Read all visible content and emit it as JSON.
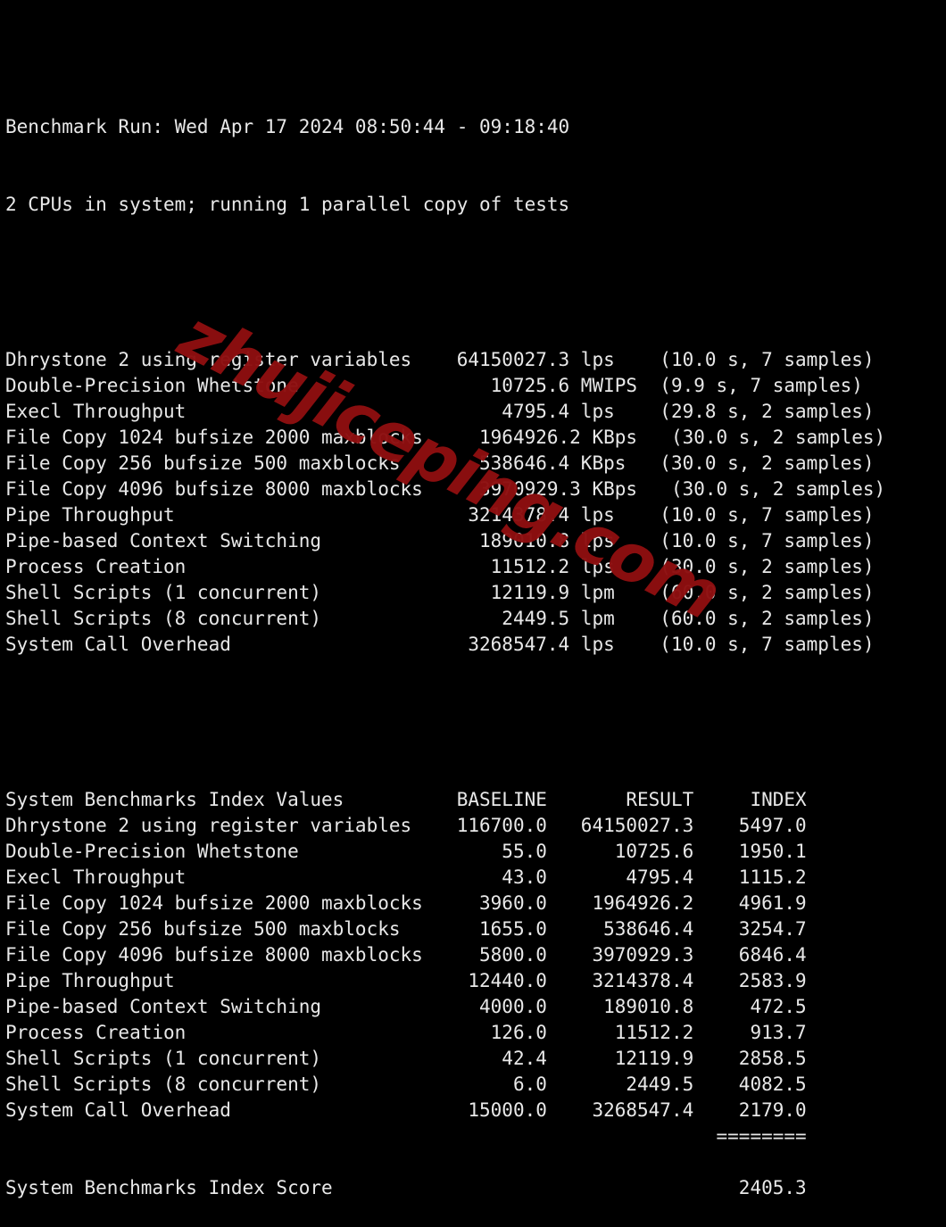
{
  "terminal": {
    "background_color": "#000000",
    "text_color": "#e8e8e8",
    "separator_top": "------------------------------------------------------------------------",
    "header": {
      "run_line": "Benchmark Run: Wed Apr 17 2024 08:50:44 - 09:18:40",
      "cpu_line": "2 CPUs in system; running 1 parallel copy of tests"
    },
    "results": {
      "rows": [
        {
          "name": "Dhrystone 2 using register variables",
          "value": "64150027.3",
          "unit": "lps",
          "detail": "(10.0 s, 7 samples)"
        },
        {
          "name": "Double-Precision Whetstone",
          "value": "10725.6",
          "unit": "MWIPS",
          "detail": "(9.9 s, 7 samples)"
        },
        {
          "name": "Execl Throughput",
          "value": "4795.4",
          "unit": "lps",
          "detail": "(29.8 s, 2 samples)"
        },
        {
          "name": "File Copy 1024 bufsize 2000 maxblocks",
          "value": "1964926.2",
          "unit": "KBps",
          "detail": "(30.0 s, 2 samples)"
        },
        {
          "name": "File Copy 256 bufsize 500 maxblocks",
          "value": "538646.4",
          "unit": "KBps",
          "detail": "(30.0 s, 2 samples)"
        },
        {
          "name": "File Copy 4096 bufsize 8000 maxblocks",
          "value": "3970929.3",
          "unit": "KBps",
          "detail": "(30.0 s, 2 samples)"
        },
        {
          "name": "Pipe Throughput",
          "value": "3214378.4",
          "unit": "lps",
          "detail": "(10.0 s, 7 samples)"
        },
        {
          "name": "Pipe-based Context Switching",
          "value": "189010.8",
          "unit": "lps",
          "detail": "(10.0 s, 7 samples)"
        },
        {
          "name": "Process Creation",
          "value": "11512.2",
          "unit": "lps",
          "detail": "(30.0 s, 2 samples)"
        },
        {
          "name": "Shell Scripts (1 concurrent)",
          "value": "12119.9",
          "unit": "lpm",
          "detail": "(60.0 s, 2 samples)"
        },
        {
          "name": "Shell Scripts (8 concurrent)",
          "value": "2449.5",
          "unit": "lpm",
          "detail": "(60.0 s, 2 samples)"
        },
        {
          "name": "System Call Overhead",
          "value": "3268547.4",
          "unit": "lps",
          "detail": "(10.0 s, 7 samples)"
        }
      ]
    },
    "index_table": {
      "title": "System Benchmarks Index Values",
      "columns": [
        "BASELINE",
        "RESULT",
        "INDEX"
      ],
      "rows": [
        {
          "name": "Dhrystone 2 using register variables",
          "baseline": "116700.0",
          "result": "64150027.3",
          "index": "5497.0"
        },
        {
          "name": "Double-Precision Whetstone",
          "baseline": "55.0",
          "result": "10725.6",
          "index": "1950.1"
        },
        {
          "name": "Execl Throughput",
          "baseline": "43.0",
          "result": "4795.4",
          "index": "1115.2"
        },
        {
          "name": "File Copy 1024 bufsize 2000 maxblocks",
          "baseline": "3960.0",
          "result": "1964926.2",
          "index": "4961.9"
        },
        {
          "name": "File Copy 256 bufsize 500 maxblocks",
          "baseline": "1655.0",
          "result": "538646.4",
          "index": "3254.7"
        },
        {
          "name": "File Copy 4096 bufsize 8000 maxblocks",
          "baseline": "5800.0",
          "result": "3970929.3",
          "index": "6846.4"
        },
        {
          "name": "Pipe Throughput",
          "baseline": "12440.0",
          "result": "3214378.4",
          "index": "2583.9"
        },
        {
          "name": "Pipe-based Context Switching",
          "baseline": "4000.0",
          "result": "189010.8",
          "index": "472.5"
        },
        {
          "name": "Process Creation",
          "baseline": "126.0",
          "result": "11512.2",
          "index": "913.7"
        },
        {
          "name": "Shell Scripts (1 concurrent)",
          "baseline": "42.4",
          "result": "12119.9",
          "index": "2858.5"
        },
        {
          "name": "Shell Scripts (8 concurrent)",
          "baseline": "6.0",
          "result": "2449.5",
          "index": "4082.5"
        },
        {
          "name": "System Call Overhead",
          "baseline": "15000.0",
          "result": "3268547.4",
          "index": "2179.0"
        }
      ],
      "score_rule": "========",
      "score_label": "System Benchmarks Index Score",
      "score_value": "2405.3"
    }
  },
  "watermark": {
    "text": "zhujiceping.com",
    "color": "#8e0f10"
  }
}
